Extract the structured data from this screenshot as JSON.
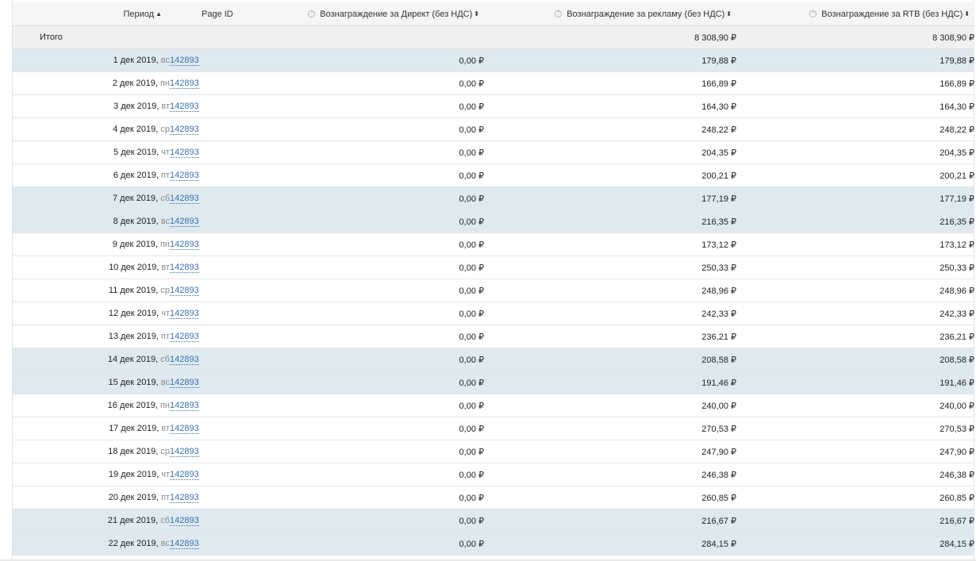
{
  "header": {
    "period": "Период",
    "period_sort": "▲",
    "page_id": "Page ID",
    "page_sort": "⬍",
    "direct": "Вознаграждение за Директ (без НДС)",
    "direct_sort": "⬍",
    "ad": "Вознаграждение за рекламу (без НДС)",
    "ad_sort": "⬍",
    "rtb": "Вознаграждение за RTB (без НДС)",
    "rtb_sort": "⬍",
    "info_glyph": "?"
  },
  "total": {
    "label": "Итого",
    "direct": "",
    "ad": "8 308,90 ₽",
    "rtb": "8 308,90 ₽"
  },
  "rows": [
    {
      "date": "1 дек 2019",
      "dow": "вс",
      "weekend": true,
      "page": "142893",
      "direct": "0,00 ₽",
      "ad": "179,88 ₽",
      "rtb": "179,88 ₽"
    },
    {
      "date": "2 дек 2019",
      "dow": "пн",
      "weekend": false,
      "page": "142893",
      "direct": "0,00 ₽",
      "ad": "166,89 ₽",
      "rtb": "166,89 ₽"
    },
    {
      "date": "3 дек 2019",
      "dow": "вт",
      "weekend": false,
      "page": "142893",
      "direct": "0,00 ₽",
      "ad": "164,30 ₽",
      "rtb": "164,30 ₽"
    },
    {
      "date": "4 дек 2019",
      "dow": "ср",
      "weekend": false,
      "page": "142893",
      "direct": "0,00 ₽",
      "ad": "248,22 ₽",
      "rtb": "248,22 ₽"
    },
    {
      "date": "5 дек 2019",
      "dow": "чт",
      "weekend": false,
      "page": "142893",
      "direct": "0,00 ₽",
      "ad": "204,35 ₽",
      "rtb": "204,35 ₽"
    },
    {
      "date": "6 дек 2019",
      "dow": "пт",
      "weekend": false,
      "page": "142893",
      "direct": "0,00 ₽",
      "ad": "200,21 ₽",
      "rtb": "200,21 ₽"
    },
    {
      "date": "7 дек 2019",
      "dow": "сб",
      "weekend": true,
      "page": "142893",
      "direct": "0,00 ₽",
      "ad": "177,19 ₽",
      "rtb": "177,19 ₽"
    },
    {
      "date": "8 дек 2019",
      "dow": "вс",
      "weekend": true,
      "page": "142893",
      "direct": "0,00 ₽",
      "ad": "216,35 ₽",
      "rtb": "216,35 ₽"
    },
    {
      "date": "9 дек 2019",
      "dow": "пн",
      "weekend": false,
      "page": "142893",
      "direct": "0,00 ₽",
      "ad": "173,12 ₽",
      "rtb": "173,12 ₽"
    },
    {
      "date": "10 дек 2019",
      "dow": "вт",
      "weekend": false,
      "page": "142893",
      "direct": "0,00 ₽",
      "ad": "250,33 ₽",
      "rtb": "250,33 ₽"
    },
    {
      "date": "11 дек 2019",
      "dow": "ср",
      "weekend": false,
      "page": "142893",
      "direct": "0,00 ₽",
      "ad": "248,96 ₽",
      "rtb": "248,96 ₽"
    },
    {
      "date": "12 дек 2019",
      "dow": "чт",
      "weekend": false,
      "page": "142893",
      "direct": "0,00 ₽",
      "ad": "242,33 ₽",
      "rtb": "242,33 ₽"
    },
    {
      "date": "13 дек 2019",
      "dow": "пт",
      "weekend": false,
      "page": "142893",
      "direct": "0,00 ₽",
      "ad": "236,21 ₽",
      "rtb": "236,21 ₽"
    },
    {
      "date": "14 дек 2019",
      "dow": "сб",
      "weekend": true,
      "page": "142893",
      "direct": "0,00 ₽",
      "ad": "208,58 ₽",
      "rtb": "208,58 ₽"
    },
    {
      "date": "15 дек 2019",
      "dow": "вс",
      "weekend": true,
      "page": "142893",
      "direct": "0,00 ₽",
      "ad": "191,46 ₽",
      "rtb": "191,46 ₽"
    },
    {
      "date": "16 дек 2019",
      "dow": "пн",
      "weekend": false,
      "page": "142893",
      "direct": "0,00 ₽",
      "ad": "240,00 ₽",
      "rtb": "240,00 ₽"
    },
    {
      "date": "17 дек 2019",
      "dow": "вт",
      "weekend": false,
      "page": "142893",
      "direct": "0,00 ₽",
      "ad": "270,53 ₽",
      "rtb": "270,53 ₽"
    },
    {
      "date": "18 дек 2019",
      "dow": "ср",
      "weekend": false,
      "page": "142893",
      "direct": "0,00 ₽",
      "ad": "247,90 ₽",
      "rtb": "247,90 ₽"
    },
    {
      "date": "19 дек 2019",
      "dow": "чт",
      "weekend": false,
      "page": "142893",
      "direct": "0,00 ₽",
      "ad": "246,38 ₽",
      "rtb": "246,38 ₽"
    },
    {
      "date": "20 дек 2019",
      "dow": "пт",
      "weekend": false,
      "page": "142893",
      "direct": "0,00 ₽",
      "ad": "260,85 ₽",
      "rtb": "260,85 ₽"
    },
    {
      "date": "21 дек 2019",
      "dow": "сб",
      "weekend": true,
      "page": "142893",
      "direct": "0,00 ₽",
      "ad": "216,67 ₽",
      "rtb": "216,67 ₽"
    },
    {
      "date": "22 дек 2019",
      "dow": "вс",
      "weekend": true,
      "page": "142893",
      "direct": "0,00 ₽",
      "ad": "284,15 ₽",
      "rtb": "284,15 ₽"
    }
  ]
}
